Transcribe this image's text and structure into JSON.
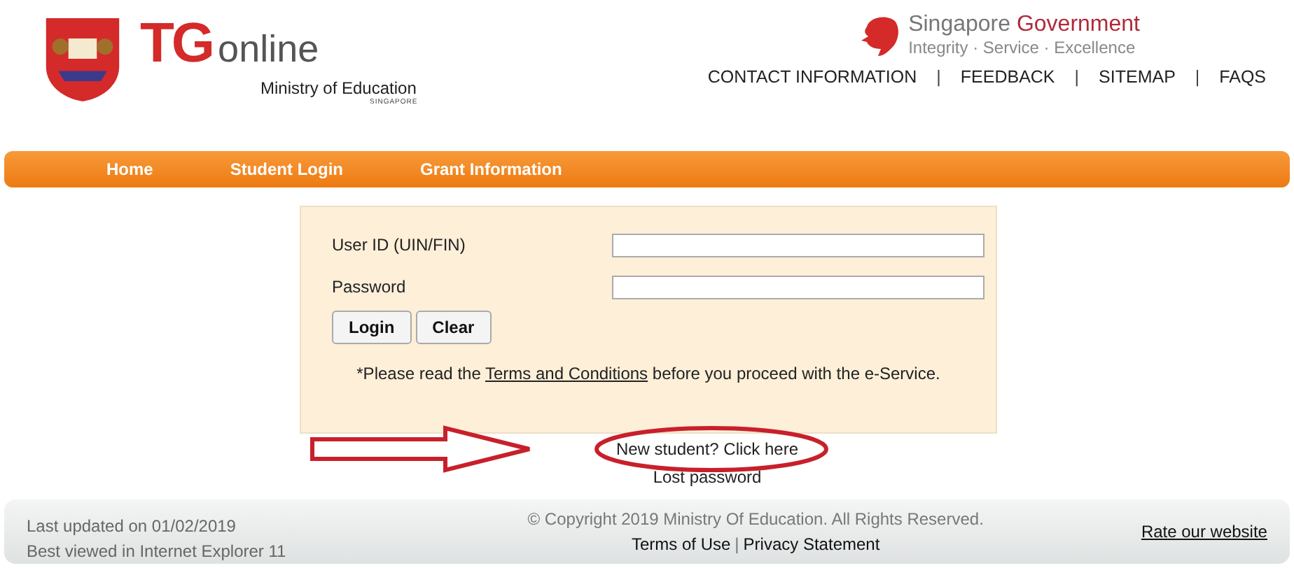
{
  "header": {
    "logo_main": "TG",
    "logo_sub": "online",
    "ministry": "Ministry of Education",
    "ministry_sub": "SINGAPORE",
    "gov_title_1": "Singapore",
    "gov_title_2": "Government",
    "gov_motto": "Integrity · Service · Excellence",
    "top_links": [
      "CONTACT INFORMATION",
      "FEEDBACK",
      "SITEMAP",
      "FAQS"
    ],
    "separator": "|"
  },
  "nav": [
    {
      "label": "Home"
    },
    {
      "label": "Student Login"
    },
    {
      "label": "Grant Information"
    }
  ],
  "login": {
    "fields": [
      {
        "label": "User ID (UIN/FIN)"
      },
      {
        "label": "Password"
      }
    ],
    "buttons": [
      "Login",
      "Clear"
    ],
    "notice_before": "*Please read the",
    "notice_link": "Terms and Conditions",
    "notice_after": "before you proceed with the e-Service."
  },
  "new_student_link": "New student? Click here",
  "lost_password_link": "Lost password",
  "footer": {
    "last_updated": "Last updated on 01/02/2019",
    "best_viewed": "Best viewed in Internet Explorer 11",
    "copyright": "© Copyright 2019 Ministry Of Education. All Rights Reserved.",
    "links": [
      "Terms of Use",
      "Privacy Statement"
    ],
    "separator": "|",
    "rate": "Rate our website"
  }
}
